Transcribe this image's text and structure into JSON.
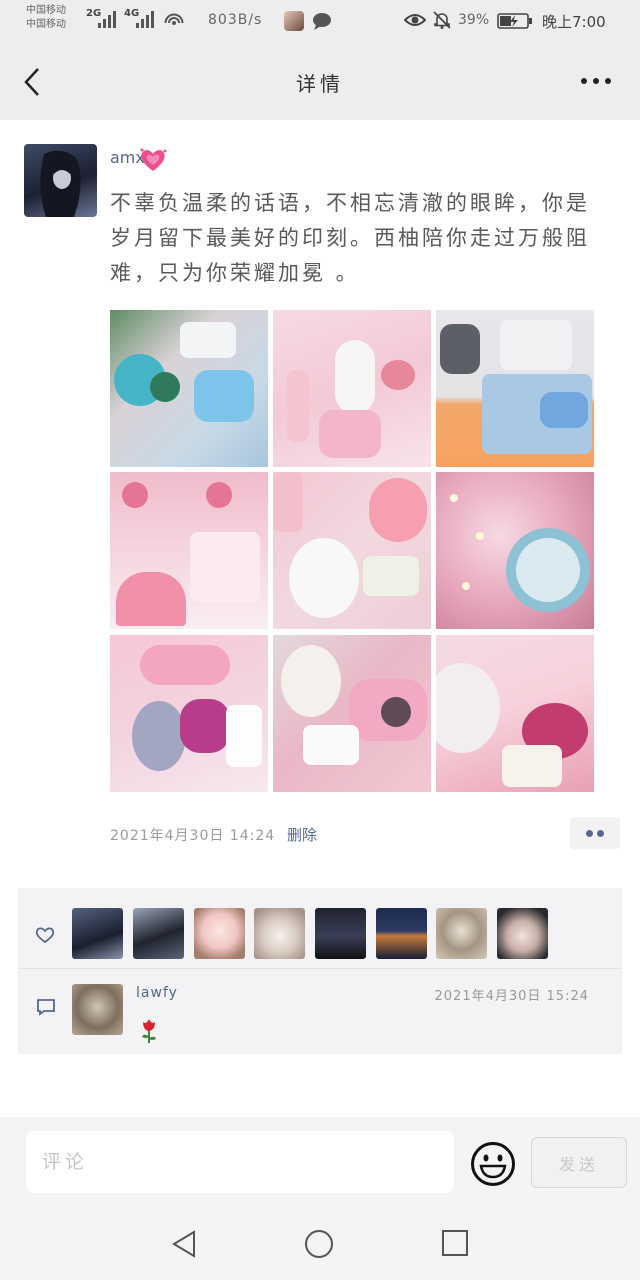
{
  "status_bar": {
    "carrier1": "中国移动",
    "carrier2": "中国移动",
    "signal1_tag": "2G",
    "signal2_tag": "4G",
    "net_speed": "803B/s",
    "battery_percent": "39%",
    "time": "晚上7:00",
    "icons": [
      "signal-icon",
      "wifi-hotspot-icon",
      "chat-bubble-icon",
      "eye-icon",
      "bell-off-icon",
      "battery-charging-icon"
    ]
  },
  "header": {
    "title": "详情",
    "back_icon": "chevron-left-icon",
    "more_icon": "more-dots-icon"
  },
  "post": {
    "author": "amx",
    "author_emoji": "sparkling-heart-icon",
    "text": "不辜负温柔的话语，不相忘清澈的眼眸，你是岁月留下最美好的印刻。西柚陪你走过万般阻难，只为你荣耀加冕 。",
    "photos": [
      "gift-box-fan-camera",
      "pink-box-bunny-camera",
      "blue-gift-box-camera",
      "flamingo-gift-box",
      "white-plush-alpaca-box",
      "fairy-lights-music-box",
      "doll-gift-box",
      "plush-pig-camera",
      "rose-petals-box"
    ],
    "date": "2021年4月30日 14:24",
    "delete_label": "删除"
  },
  "likes": {
    "icon": "heart-outline-icon",
    "avatars": [
      "avatar-dark-girl-1",
      "avatar-dark-girl-2",
      "avatar-anime-girl",
      "avatar-kitten",
      "avatar-girl-night",
      "avatar-couple-night",
      "avatar-pug",
      "avatar-girl-cap"
    ]
  },
  "comment": {
    "icon": "comment-icon",
    "user": "lawfy",
    "date": "2021年4月30日 15:24",
    "content_emoji": "rose-icon"
  },
  "input_bar": {
    "placeholder": "评论",
    "emoji_icon": "smiley-icon",
    "send_label": "发送"
  },
  "nav_bar": {
    "icons": [
      "nav-back-icon",
      "nav-home-icon",
      "nav-recent-icon"
    ]
  },
  "colors": {
    "header_bg": "#ededed",
    "link_blue": "#57688f",
    "interact_bg": "#f3f3f5"
  }
}
